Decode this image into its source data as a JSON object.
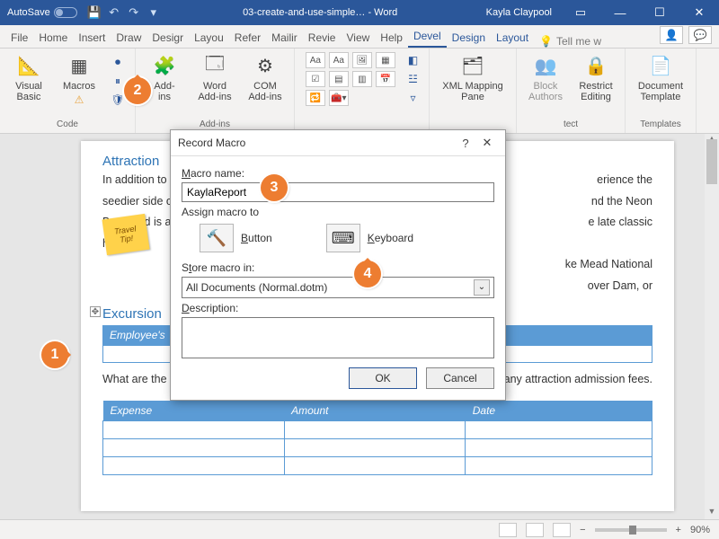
{
  "titlebar": {
    "autosave": "AutoSave",
    "doc_title": "03-create-and-use-simple… - Word",
    "user": "Kayla Claypool"
  },
  "tabs": {
    "file": "File",
    "home": "Home",
    "insert": "Insert",
    "draw": "Draw",
    "design": "Desigr",
    "layout": "Layou",
    "references": "Refer",
    "mailings": "Mailir",
    "review": "Revie",
    "view": "View",
    "help": "Help",
    "developer": "Devel",
    "tdesign": "Design",
    "tlayout": "Layout",
    "tellme": "Tell me w"
  },
  "ribbon": {
    "group_code": "Code",
    "visual_basic": "Visual\nBasic",
    "macros": "Macros",
    "group_addins": "Add-ins",
    "addins": "Add-\nins",
    "word_addins": "Word\nAdd-ins",
    "com_addins": "COM\nAdd-ins",
    "mini_aa": "Aa",
    "xml_mapping": "XML Mapping\nPane",
    "block_authors": "Block\nAuthors",
    "restrict_editing": "Restrict\nEditing",
    "group_templates": "Templates",
    "doc_template": "Document\nTemplate",
    "protect_trunc": "tect"
  },
  "doc": {
    "h_attractions": "Attraction",
    "para1": "In addition to",
    "para1b": "erience the",
    "para2": "seedier side of",
    "para2b": "nd the Neon",
    "para3": "Boneyard is a",
    "para3b": "e late classic",
    "para4": "hotels.",
    "travel_tip": "Travel\nTip!",
    "tip_line1": "ke Mead National",
    "tip_line2": "over Dam, or",
    "h_excursion": "Excursion",
    "emp_header": "Employee's ",
    "q_intro": "What are the",
    "q_intro2": "avel (including transit passes and car fare), and any attraction admission fees.",
    "col_expense": "Expense",
    "col_amount": "Amount",
    "col_date": "Date"
  },
  "dialog": {
    "title": "Record Macro",
    "macro_name_label": "Macro name:",
    "macro_name_value": "KaylaReport",
    "assign_label": "Assign macro to",
    "button_label": "Button",
    "keyboard_label": "Keyboard",
    "store_label": "Store macro in:",
    "store_value": "All Documents (Normal.dotm)",
    "description_label": "Description:",
    "ok": "OK",
    "cancel": "Cancel"
  },
  "status": {
    "zoom": "90%"
  },
  "callouts": {
    "c1": "1",
    "c2": "2",
    "c3": "3",
    "c4": "4"
  }
}
